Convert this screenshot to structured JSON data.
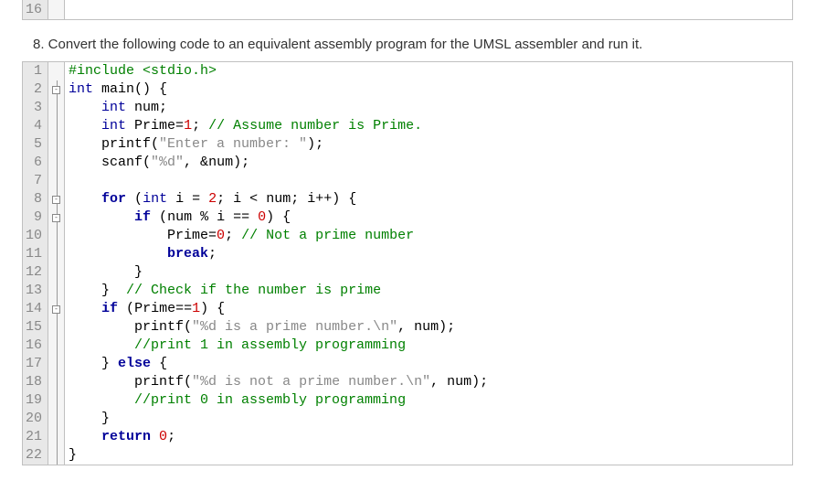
{
  "question": "8. Convert the following code to an equivalent assembly program for the UMSL assembler and run it.",
  "top_cut_lineno": "16",
  "lines": [
    {
      "n": "1",
      "fold": "",
      "html": "<span class='pp'>#include &lt;stdio.h&gt;</span>"
    },
    {
      "n": "2",
      "fold": "box",
      "html": "<span class='ty'>int</span> main<span class='op'>() {</span>"
    },
    {
      "n": "3",
      "fold": "line",
      "html": "    <span class='ty'>int</span> num<span class='op'>;</span>"
    },
    {
      "n": "4",
      "fold": "line",
      "html": "    <span class='ty'>int</span> Prime<span class='op'>=</span><span class='num'>1</span><span class='op'>;</span> <span class='cm'>// Assume number is Prime.</span>"
    },
    {
      "n": "5",
      "fold": "line",
      "html": "    printf<span class='op'>(</span><span class='str'>\"Enter a number: \"</span><span class='op'>);</span>"
    },
    {
      "n": "6",
      "fold": "line",
      "html": "    scanf<span class='op'>(</span><span class='str'>\"%d\"</span><span class='op'>, &amp;</span>num<span class='op'>);</span>"
    },
    {
      "n": "7",
      "fold": "line",
      "html": ""
    },
    {
      "n": "8",
      "fold": "box",
      "html": "    <span class='kw'>for</span> <span class='op'>(</span><span class='ty'>int</span> i <span class='op'>=</span> <span class='num'>2</span><span class='op'>;</span> i <span class='op'>&lt;</span> num<span class='op'>;</span> i<span class='op'>++) {</span>"
    },
    {
      "n": "9",
      "fold": "box",
      "html": "        <span class='kw'>if</span> <span class='op'>(</span>num <span class='op'>%</span> i <span class='op'>==</span> <span class='num'>0</span><span class='op'>) {</span>"
    },
    {
      "n": "10",
      "fold": "line",
      "html": "            Prime<span class='op'>=</span><span class='num'>0</span><span class='op'>;</span> <span class='cm'>// Not a prime number</span>"
    },
    {
      "n": "11",
      "fold": "line",
      "html": "            <span class='kw'>break</span><span class='op'>;</span>"
    },
    {
      "n": "12",
      "fold": "line",
      "html": "        <span class='op'>}</span>"
    },
    {
      "n": "13",
      "fold": "line",
      "html": "    <span class='op'>}</span>  <span class='cm'>// Check if the number is prime</span>"
    },
    {
      "n": "14",
      "fold": "box",
      "html": "    <span class='kw'>if</span> <span class='op'>(</span>Prime<span class='op'>==</span><span class='num'>1</span><span class='op'>) {</span>"
    },
    {
      "n": "15",
      "fold": "line",
      "html": "        printf<span class='op'>(</span><span class='str'>\"%d is a prime number.\\n\"</span><span class='op'>,</span> num<span class='op'>);</span>"
    },
    {
      "n": "16",
      "fold": "line",
      "html": "        <span class='cm'>//print 1 in assembly programming</span>"
    },
    {
      "n": "17",
      "fold": "line",
      "html": "    <span class='op'>}</span> <span class='kw'>else</span> <span class='op'>{</span>"
    },
    {
      "n": "18",
      "fold": "line",
      "html": "        printf<span class='op'>(</span><span class='str'>\"%d is not a prime number.\\n\"</span><span class='op'>,</span> num<span class='op'>);</span>"
    },
    {
      "n": "19",
      "fold": "line",
      "html": "        <span class='cm'>//print 0 in assembly programming</span>"
    },
    {
      "n": "20",
      "fold": "line",
      "html": "    <span class='op'>}</span>"
    },
    {
      "n": "21",
      "fold": "line",
      "html": "    <span class='kw'>return</span> <span class='num'>0</span><span class='op'>;</span>"
    },
    {
      "n": "22",
      "fold": "line",
      "html": "<span class='op'>}</span>"
    }
  ]
}
